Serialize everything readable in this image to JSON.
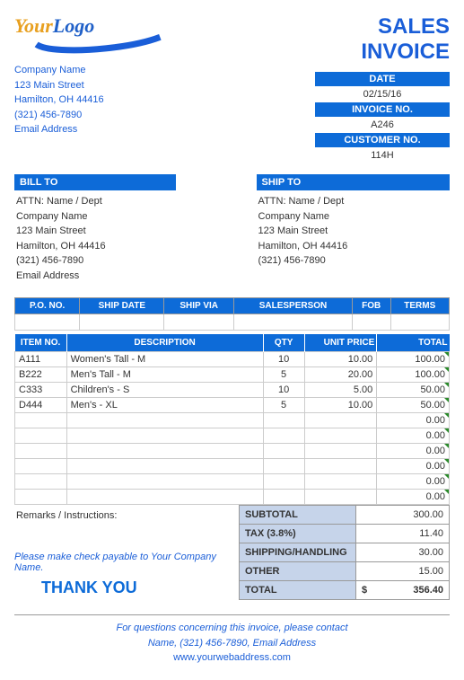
{
  "logo": {
    "your": "Your",
    "logo": "Logo"
  },
  "company": {
    "name": "Company Name",
    "street": "123 Main Street",
    "city": "Hamilton, OH  44416",
    "phone": "(321) 456-7890",
    "email": "Email Address"
  },
  "title": {
    "line1": "SALES",
    "line2": "INVOICE"
  },
  "meta": {
    "date_label": "DATE",
    "date_value": "02/15/16",
    "invno_label": "INVOICE NO.",
    "invno_value": "A246",
    "custno_label": "CUSTOMER NO.",
    "custno_value": "114H"
  },
  "billto": {
    "header": "BILL TO",
    "attn": "ATTN: Name / Dept",
    "name": "Company Name",
    "street": "123 Main Street",
    "city": "Hamilton, OH  44416",
    "phone": "(321) 456-7890",
    "email": "Email Address"
  },
  "shipto": {
    "header": "SHIP TO",
    "attn": "ATTN: Name / Dept",
    "name": "Company Name",
    "street": "123 Main Street",
    "city": "Hamilton, OH  44416",
    "phone": "(321) 456-7890"
  },
  "shipcols": {
    "pono": "P.O. NO.",
    "shipdate": "SHIP DATE",
    "shipvia": "SHIP VIA",
    "salesperson": "SALESPERSON",
    "fob": "FOB",
    "terms": "TERMS"
  },
  "itemcols": {
    "item": "ITEM NO.",
    "desc": "DESCRIPTION",
    "qty": "QTY",
    "price": "UNIT PRICE",
    "total": "TOTAL"
  },
  "items": [
    {
      "no": "A111",
      "desc": "Women's Tall - M",
      "qty": "10",
      "price": "10.00",
      "total": "100.00"
    },
    {
      "no": "B222",
      "desc": "Men's Tall - M",
      "qty": "5",
      "price": "20.00",
      "total": "100.00"
    },
    {
      "no": "C333",
      "desc": "Children's - S",
      "qty": "10",
      "price": "5.00",
      "total": "50.00"
    },
    {
      "no": "D444",
      "desc": "Men's - XL",
      "qty": "5",
      "price": "10.00",
      "total": "50.00"
    }
  ],
  "zero": "0.00",
  "remarks": "Remarks / Instructions:",
  "totals": {
    "subtotal_label": "SUBTOTAL",
    "subtotal": "300.00",
    "tax_label": "TAX (3.8%)",
    "tax": "11.40",
    "ship_label": "SHIPPING/HANDLING",
    "ship": "30.00",
    "other_label": "OTHER",
    "other": "15.00",
    "total_label": "TOTAL",
    "currency": "$",
    "total": "356.40"
  },
  "payable": "Please make check payable to Your Company Name.",
  "thankyou": "THANK YOU",
  "footer": {
    "line1": "For questions concerning this invoice, please contact",
    "line2": "Name, (321) 456-7890, Email Address",
    "web": "www.yourwebaddress.com"
  }
}
